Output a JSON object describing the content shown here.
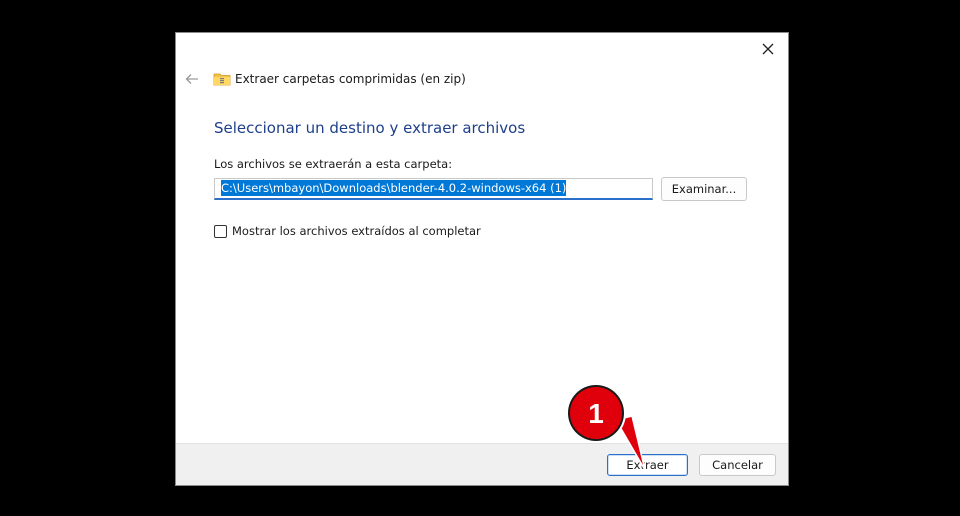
{
  "dialog": {
    "header_title": "Extraer carpetas comprimidas (en zip)",
    "heading": "Seleccionar un destino y extraer archivos",
    "path_label": "Los archivos se extraerán a esta carpeta:",
    "path_value": "C:\\Users\\mbayon\\Downloads\\blender-4.0.2-windows-x64 (1)",
    "browse_label": "Examinar...",
    "checkbox_label": "Mostrar los archivos extraídos al completar",
    "checkbox_checked": false,
    "extract_label": "Extraer",
    "cancel_label": "Cancelar"
  },
  "annotation": {
    "step_number": "1",
    "color": "#e0000b"
  },
  "icons": [
    "close-icon",
    "back-arrow-icon",
    "zip-folder-icon"
  ]
}
